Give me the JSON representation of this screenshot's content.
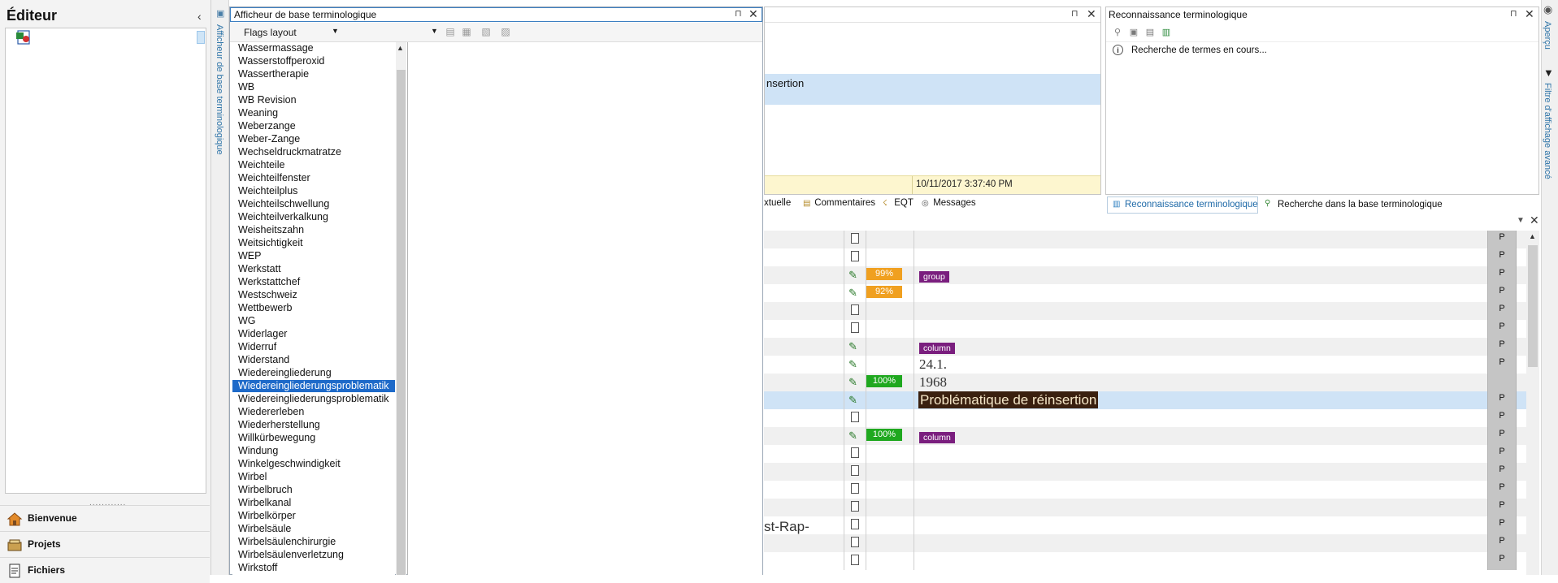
{
  "editor": {
    "title": "Éditeur",
    "collapse": "‹",
    "grip": "............",
    "nav": [
      {
        "label": "Bienvenue",
        "icon": "home-icon"
      },
      {
        "label": "Projets",
        "icon": "projects-icon"
      },
      {
        "label": "Fichiers",
        "icon": "files-icon"
      }
    ]
  },
  "vstrip": {
    "label": "Afficheur de base terminologique",
    "icon": "termbase-viewer-icon"
  },
  "termbase": {
    "title": "Afficheur de base terminologique",
    "layout_value": "Flags layout",
    "pin": "⊓",
    "close": "✕",
    "terms": [
      "Wassermassage",
      "Wasserstoffperoxid",
      "Wassertherapie",
      "WB",
      "WB Revision",
      "Weaning",
      "Weberzange",
      "Weber-Zange",
      "Wechseldruckmatratze",
      "Weichteile",
      "Weichteilfenster",
      "Weichteilplus",
      "Weichteilschwellung",
      "Weichteilverkalkung",
      "Weisheitszahn",
      "Weitsichtigkeit",
      "WEP",
      "Werkstatt",
      "Werkstattchef",
      "Westschweiz",
      "Wettbewerb",
      "WG",
      "Widerlager",
      "Widerruf",
      "Widerstand",
      "Wiedereingliederung",
      "Wiedereingliederungsproblematik",
      "Wiedereingliederungsproblematik",
      "Wiedererleben",
      "Wiederherstellung",
      "Willkürbewegung",
      "Windung",
      "Winkelgeschwindigkeit",
      "Wirbel",
      "Wirbelbruch",
      "Wirbelkanal",
      "Wirbelkörper",
      "Wirbelsäule",
      "Wirbelsäulenchirurgie",
      "Wirbelsäulenverletzung",
      "Wirkstoff"
    ],
    "selected_index": 26
  },
  "mid": {
    "text": "nsertion",
    "date": "10/11/2017 3:37:40 PM",
    "pin": "⊓",
    "close": "✕",
    "tabs": [
      {
        "label": "xtuelle",
        "icon": ""
      },
      {
        "label": "Commentaires",
        "icon": "▤"
      },
      {
        "label": "EQT",
        "icon": "☇"
      },
      {
        "label": "Messages",
        "icon": "◎"
      }
    ]
  },
  "term_recognition": {
    "title": "Reconnaissance terminologique",
    "info": "Recherche de termes en cours...",
    "tab1": "Reconnaissance terminologique",
    "tab2": "Recherche dans la base terminologique",
    "pin": "⊓",
    "close": "✕"
  },
  "right_strip": {
    "apercu": "Aperçu",
    "filter": "Filtre d'affichage avancé"
  },
  "grid": {
    "menu": "▼",
    "close": "✕",
    "rows": [
      {
        "icon": "doc",
        "pct": "",
        "pct_color": "",
        "tag": "",
        "target": "",
        "source": "",
        "p": "P",
        "bg": "alt"
      },
      {
        "icon": "doc",
        "pct": "",
        "pct_color": "",
        "tag": "",
        "target": "",
        "source": "",
        "p": "P",
        "bg": ""
      },
      {
        "icon": "tm",
        "pct": "99%",
        "pct_color": "#f0a020",
        "tag": "group",
        "target": "",
        "source": "",
        "p": "P",
        "bg": "alt"
      },
      {
        "icon": "tm",
        "pct": "92%",
        "pct_color": "#f0a020",
        "tag": "",
        "target": "",
        "source": "",
        "p": "P",
        "bg": ""
      },
      {
        "icon": "doc",
        "pct": "",
        "pct_color": "",
        "tag": "",
        "target": "",
        "source": "",
        "p": "P",
        "bg": "alt"
      },
      {
        "icon": "doc",
        "pct": "",
        "pct_color": "",
        "tag": "",
        "target": "",
        "source": "",
        "p": "P",
        "bg": ""
      },
      {
        "icon": "tm",
        "pct": "",
        "pct_color": "",
        "tag": "column",
        "target": "",
        "source": "",
        "p": "P",
        "bg": "alt"
      },
      {
        "icon": "tm",
        "pct": "",
        "pct_color": "",
        "tag": "",
        "target": "24.1.",
        "source": "",
        "p": "P",
        "bg": ""
      },
      {
        "icon": "tm",
        "pct": "100%",
        "pct_color": "#1fa81f",
        "tag": "",
        "target": "1968",
        "source": "",
        "p": "",
        "bg": "alt"
      },
      {
        "icon": "tm",
        "pct": "",
        "pct_color": "",
        "tag": "",
        "target": "Problématique de réinsertion",
        "source": "",
        "p": "P",
        "bg": "sel",
        "highlight": true
      },
      {
        "icon": "doc",
        "pct": "",
        "pct_color": "",
        "tag": "",
        "target": "",
        "source": "",
        "p": "P",
        "bg": ""
      },
      {
        "icon": "tm",
        "pct": "100%",
        "pct_color": "#1fa81f",
        "tag": "column",
        "target": "",
        "source": "",
        "p": "P",
        "bg": "alt"
      },
      {
        "icon": "doc",
        "pct": "",
        "pct_color": "",
        "tag": "",
        "target": "",
        "source": "",
        "p": "P",
        "bg": ""
      },
      {
        "icon": "doc",
        "pct": "",
        "pct_color": "",
        "tag": "",
        "target": "",
        "source": "",
        "p": "P",
        "bg": "alt"
      },
      {
        "icon": "doc",
        "pct": "",
        "pct_color": "",
        "tag": "",
        "target": "",
        "source": "",
        "p": "P",
        "bg": ""
      },
      {
        "icon": "doc",
        "pct": "",
        "pct_color": "",
        "tag": "",
        "target": "",
        "source": "",
        "p": "P",
        "bg": "alt"
      },
      {
        "icon": "doc",
        "pct": "",
        "pct_color": "",
        "tag": "",
        "target": "",
        "source": "st-Rap-",
        "p": "P",
        "bg": ""
      },
      {
        "icon": "doc",
        "pct": "",
        "pct_color": "",
        "tag": "",
        "target": "",
        "source": "",
        "p": "P",
        "bg": "alt"
      },
      {
        "icon": "doc",
        "pct": "",
        "pct_color": "",
        "tag": "",
        "target": "",
        "source": "",
        "p": "P",
        "bg": ""
      }
    ]
  },
  "colors": {
    "selection": "#1e6ac9",
    "highlight_row": "#cfe3f6",
    "tag": "#7a1e7e",
    "match_high": "#1fa81f",
    "match_fuzzy": "#f0a020"
  }
}
